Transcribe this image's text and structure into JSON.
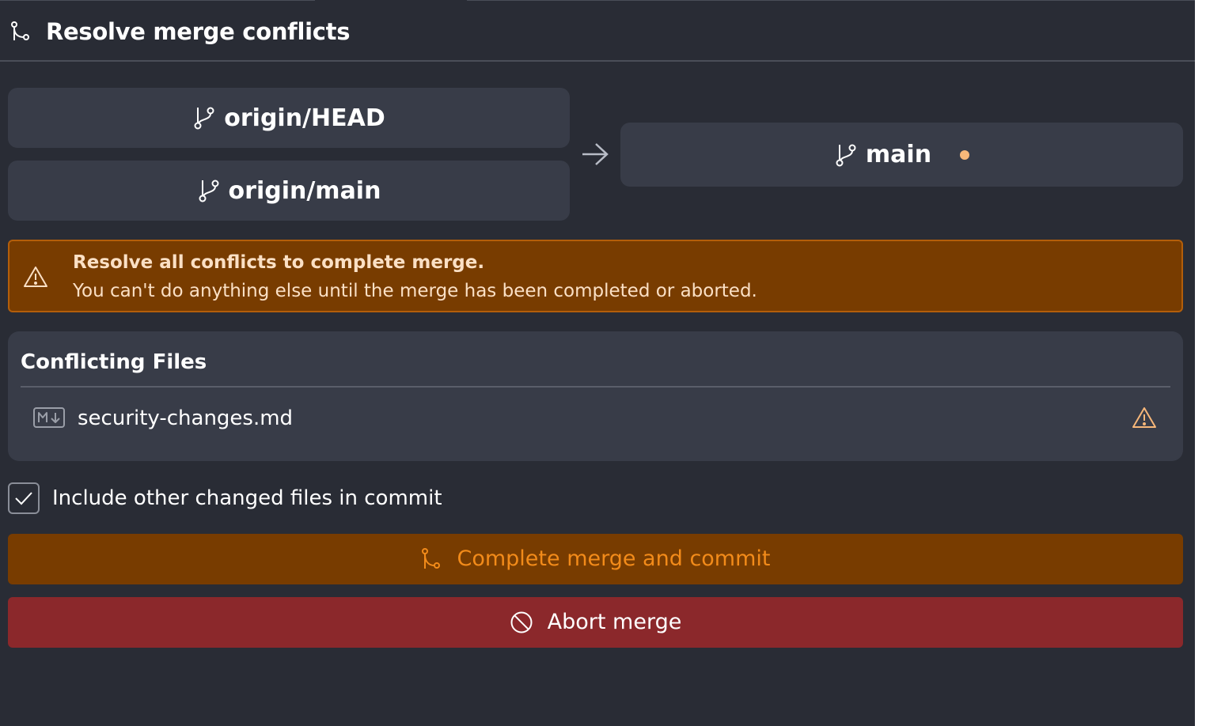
{
  "header": {
    "title": "Resolve merge conflicts",
    "icon": "git-merge-icon"
  },
  "branches": {
    "sources": [
      {
        "label": "origin/HEAD",
        "icon": "git-branch-icon"
      },
      {
        "label": "origin/main",
        "icon": "git-branch-icon"
      }
    ],
    "target": {
      "label": "main",
      "icon": "git-branch-icon",
      "indicator_color": "#f7b779"
    },
    "arrow_icon": "arrow-right-icon"
  },
  "warning": {
    "title": "Resolve all conflicts to complete merge.",
    "message": "You can't do anything else until the merge has been completed or aborted.",
    "icon": "warning-triangle-icon",
    "background": "#783c00",
    "border": "#b35e0a"
  },
  "conflicting_files": {
    "title": "Conflicting Files",
    "files": [
      {
        "name": "security-changes.md",
        "type_icon": "markdown-icon",
        "status_icon": "warning-triangle-icon"
      }
    ]
  },
  "include_changed": {
    "label": "Include other changed files in commit",
    "checked": true
  },
  "actions": {
    "complete": {
      "label": "Complete merge and commit",
      "icon": "git-merge-icon",
      "background": "#783c00",
      "color": "#f28b1a"
    },
    "abort": {
      "label": "Abort merge",
      "icon": "ban-icon",
      "background": "#8b282b",
      "color": "#ffffff"
    }
  },
  "colors": {
    "panel_bg": "#292c35",
    "card_bg": "#383c48"
  }
}
